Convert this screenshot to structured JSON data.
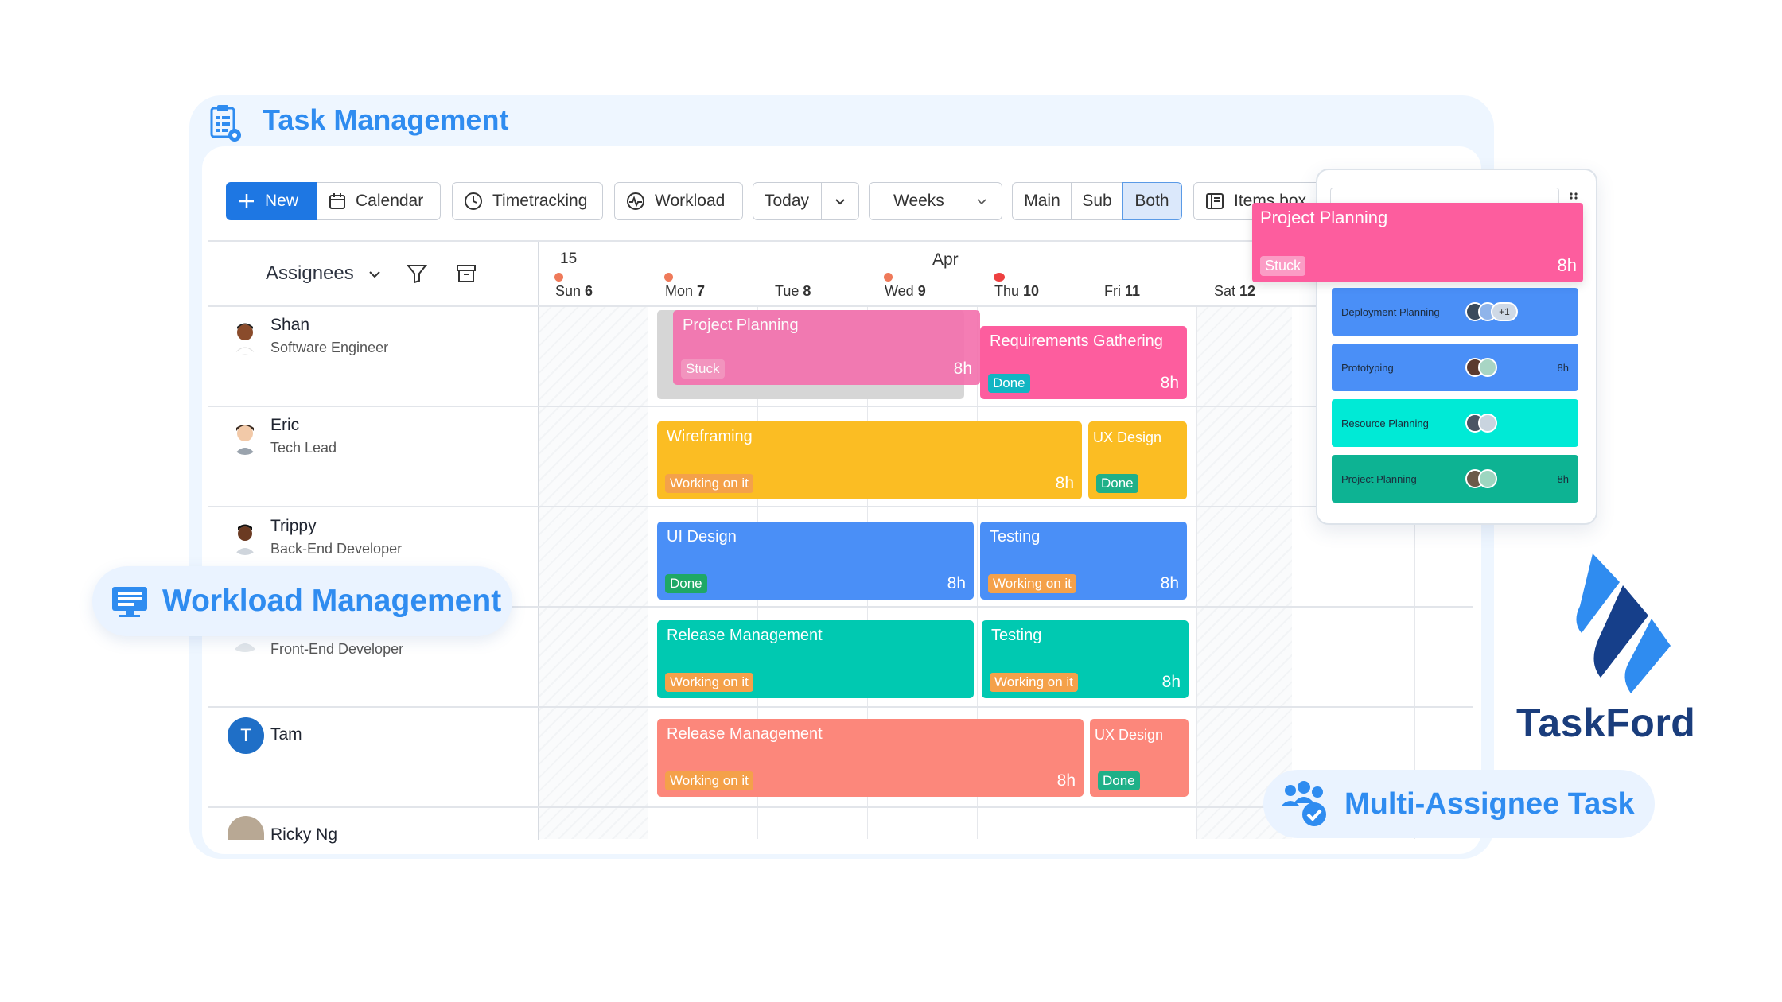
{
  "app": {
    "title": "Task Management"
  },
  "toolbar": {
    "new": "New",
    "calendar": "Calendar",
    "timetracking": "Timetracking",
    "workload": "Workload",
    "today": "Today",
    "weeks": "Weeks",
    "main": "Main",
    "sub": "Sub",
    "both": "Both",
    "items_box": "Items box"
  },
  "grid": {
    "assignees_label": "Assignees",
    "week_number": "15",
    "month": "Apr",
    "days": [
      {
        "name": "Sun",
        "num": "6"
      },
      {
        "name": "Mon",
        "num": "7"
      },
      {
        "name": "Tue",
        "num": "8"
      },
      {
        "name": "Wed",
        "num": "9"
      },
      {
        "name": "Thu",
        "num": "10"
      },
      {
        "name": "Fri",
        "num": "11"
      },
      {
        "name": "Sat",
        "num": "12"
      }
    ]
  },
  "people": [
    {
      "name": "Shan",
      "role": "Software Engineer"
    },
    {
      "name": "Eric",
      "role": "Tech Lead"
    },
    {
      "name": "Trippy",
      "role": "Back-End Developer"
    },
    {
      "name": "",
      "role": "Front-End Developer"
    },
    {
      "name": "Tam",
      "role": "",
      "initial": "T"
    },
    {
      "name": "Ricky Ng",
      "role": ""
    }
  ],
  "tasks": [
    {
      "title": "Project Planning",
      "status": "Stuck",
      "hours": "8h",
      "color": "#f472ae"
    },
    {
      "title": "Requirements Gathering",
      "status": "Done",
      "hours": "8h",
      "color": "#fd5d9e"
    },
    {
      "title": "Wireframing",
      "status": "Working on it",
      "hours": "8h",
      "color": "#fbbd23"
    },
    {
      "title": "UX Design",
      "status": "Done",
      "hours": "",
      "color": "#fbbd23"
    },
    {
      "title": "UI Design",
      "status": "Done",
      "hours": "8h",
      "color": "#4a8ff7"
    },
    {
      "title": "Testing",
      "status": "Working on it",
      "hours": "8h",
      "color": "#4a8ff7"
    },
    {
      "title": "Release Management",
      "status": "Working on it",
      "hours": "",
      "color": "#00c9b1"
    },
    {
      "title": "Testing",
      "status": "Working on it",
      "hours": "8h",
      "color": "#00c9b1"
    },
    {
      "title": "Release Management",
      "status": "Working on it",
      "hours": "8h",
      "color": "#fc877b"
    },
    {
      "title": "UX Design",
      "status": "Done",
      "hours": "",
      "color": "#fc877b"
    }
  ],
  "drag_card": {
    "title": "Project Planning",
    "status": "Stuck",
    "hours": "8h"
  },
  "items_box": {
    "items": [
      {
        "title": "Deployment Planning",
        "hours": "",
        "extra": "+1",
        "color": "#4a8ff7"
      },
      {
        "title": "Prototyping",
        "hours": "8h",
        "color": "#4a8ff7"
      },
      {
        "title": "Resource Planning",
        "hours": "",
        "color": "#00ead6"
      },
      {
        "title": "Project Planning",
        "hours": "8h",
        "color": "#0db393"
      }
    ]
  },
  "badges": {
    "workload": "Workload Management",
    "multi": "Multi-Assignee Task"
  },
  "brand": {
    "name": "TaskFord"
  }
}
